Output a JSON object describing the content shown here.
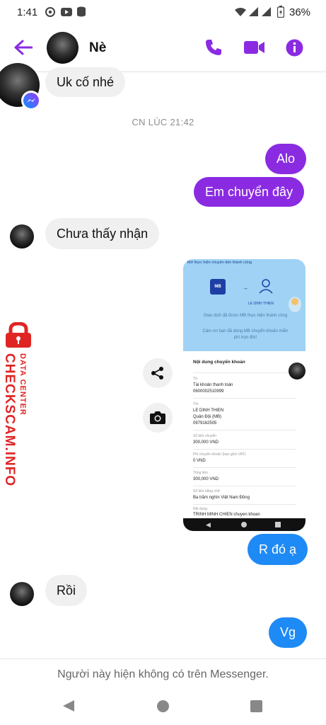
{
  "status_bar": {
    "time": "1:41",
    "battery": "36%"
  },
  "header": {
    "contact_name": "Nè"
  },
  "messages": {
    "m1": "Uk cố nhé",
    "timestamp": "CN LÚC 21:42",
    "m2": "Alo",
    "m3": "Em chuyển đây",
    "m4": "Chưa thấy nhận",
    "m5": "R đó ạ",
    "m6": "Rồi",
    "m7": "Vg"
  },
  "shared_image": {
    "banner": "Mở thực hiện chuyển tiền thành công",
    "from_bank": "MB",
    "to_name": "LE DINH THIEN",
    "success": "Giao dịch đã được MB thực hiện thành công",
    "thanks": "Cảm ơn bạn đã dùng MB chuyển khoản miễn phí trọn đời!",
    "section_title": "Nội dung chuyển khoản",
    "rows": [
      {
        "label": "Từ",
        "value": "Tài khoản thanh toán",
        "value2": "0600002510999"
      },
      {
        "label": "Tới",
        "value": "LE DINH THIEN",
        "value2": "Quân Đội (MB)",
        "value3": "0979162505"
      },
      {
        "label": "Số tiền chuyển",
        "value": "300,000 VND"
      },
      {
        "label": "Phí chuyển khoản (bao gồm VAT)",
        "value": "0 VND"
      },
      {
        "label": "Tổng tiền",
        "value": "300,000 VND"
      },
      {
        "label": "Số tiền bằng chữ",
        "value": "Ba trăm nghìn Việt Nam Đồng"
      },
      {
        "label": "Nội dung",
        "value": "TRINH MINH CHIEN chuyen khoan"
      }
    ]
  },
  "watermark": {
    "line1": "DATA CENTER",
    "line2": "CHECKSCAM.INFO"
  },
  "footer": {
    "notice": "Người này hiện không có trên Messenger."
  },
  "colors": {
    "accent": "#8a2be2",
    "blue_bubble": "#1e8af5",
    "bubble_in": "#f0f0f0",
    "watermark": "#e02424"
  }
}
